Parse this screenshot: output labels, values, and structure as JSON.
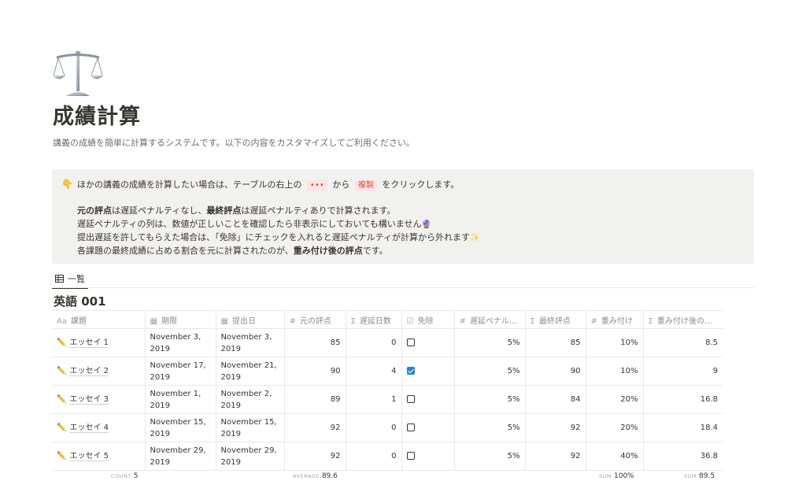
{
  "page": {
    "title": "成績計算",
    "description": "講義の成績を簡単に計算するシステムです。以下の内容をカスタマイズしてご利用ください。"
  },
  "callout": {
    "icon": "👇",
    "line1_before": "ほかの講義の成績を計算したい場合は、テーブルの右上の",
    "dots": "•••",
    "line1_mid": "から",
    "duplicate": "複製",
    "line1_after": "をクリックします。",
    "l2_bold1": "元の評点",
    "l2_text1": "は遅延ペナルティなし、",
    "l2_bold2": "最終評点",
    "l2_text2": "は遅延ペナルティありで計算されます。",
    "l3_text": "遅延ペナルティの列は、数値が正しいことを確認したら非表示にしておいても構いません",
    "l3_emoji": "🔮",
    "l4_text": "提出遅延を許してもらえた場合は、「免除」にチェックを入れると遅延ペナルティが計算から外れます",
    "l4_emoji": "✨",
    "l5_text": "各課題の最終成績に占める割合を元に計算されたのが、",
    "l5_bold": "重み付け後の評点",
    "l5_end": "です。"
  },
  "view": {
    "tab_label": "一覧"
  },
  "database": {
    "title": "英語 001",
    "columns": [
      {
        "icon": "Aa",
        "label": "課題"
      },
      {
        "icon": "▦",
        "label": "期限"
      },
      {
        "icon": "▦",
        "label": "提出日"
      },
      {
        "icon": "#",
        "label": "元の評点"
      },
      {
        "icon": "Σ",
        "label": "遅延日数"
      },
      {
        "icon": "☑",
        "label": "免除"
      },
      {
        "icon": "#",
        "label": "遅延ペナル…"
      },
      {
        "icon": "Σ",
        "label": "最終評点"
      },
      {
        "icon": "#",
        "label": "重み付け"
      },
      {
        "icon": "Σ",
        "label": "重み付け後の…"
      }
    ],
    "rows": [
      {
        "icon": "✏️",
        "name": "エッセイ 1",
        "due": "November 3, 2019",
        "submitted": "November 3, 2019",
        "original": "85",
        "late_days": "0",
        "excused": false,
        "penalty": "5%",
        "final": "85",
        "weight": "10%",
        "weighted": "8.5"
      },
      {
        "icon": "✏️",
        "name": "エッセイ 2",
        "due": "November 17, 2019",
        "submitted": "November 21, 2019",
        "original": "90",
        "late_days": "4",
        "excused": true,
        "penalty": "5%",
        "final": "90",
        "weight": "10%",
        "weighted": "9"
      },
      {
        "icon": "✏️",
        "name": "エッセイ 3",
        "due": "November 1, 2019",
        "submitted": "November 2, 2019",
        "original": "89",
        "late_days": "1",
        "excused": false,
        "penalty": "5%",
        "final": "84",
        "weight": "20%",
        "weighted": "16.8"
      },
      {
        "icon": "✏️",
        "name": "エッセイ 4",
        "due": "November 15, 2019",
        "submitted": "November 15, 2019",
        "original": "92",
        "late_days": "0",
        "excused": false,
        "penalty": "5%",
        "final": "92",
        "weight": "20%",
        "weighted": "18.4"
      },
      {
        "icon": "✏️",
        "name": "エッセイ 5",
        "due": "November 29, 2019",
        "submitted": "November 29, 2019",
        "original": "92",
        "late_days": "0",
        "excused": false,
        "penalty": "5%",
        "final": "92",
        "weight": "40%",
        "weighted": "36.8"
      }
    ],
    "calculations": {
      "count_label": "COUNT",
      "count_value": "5",
      "avg_label": "AVERAGE",
      "avg_value": "89.6",
      "sum1_label": "SUM",
      "sum1_value": "100%",
      "sum2_label": "SUM",
      "sum2_value": "89.5"
    }
  }
}
